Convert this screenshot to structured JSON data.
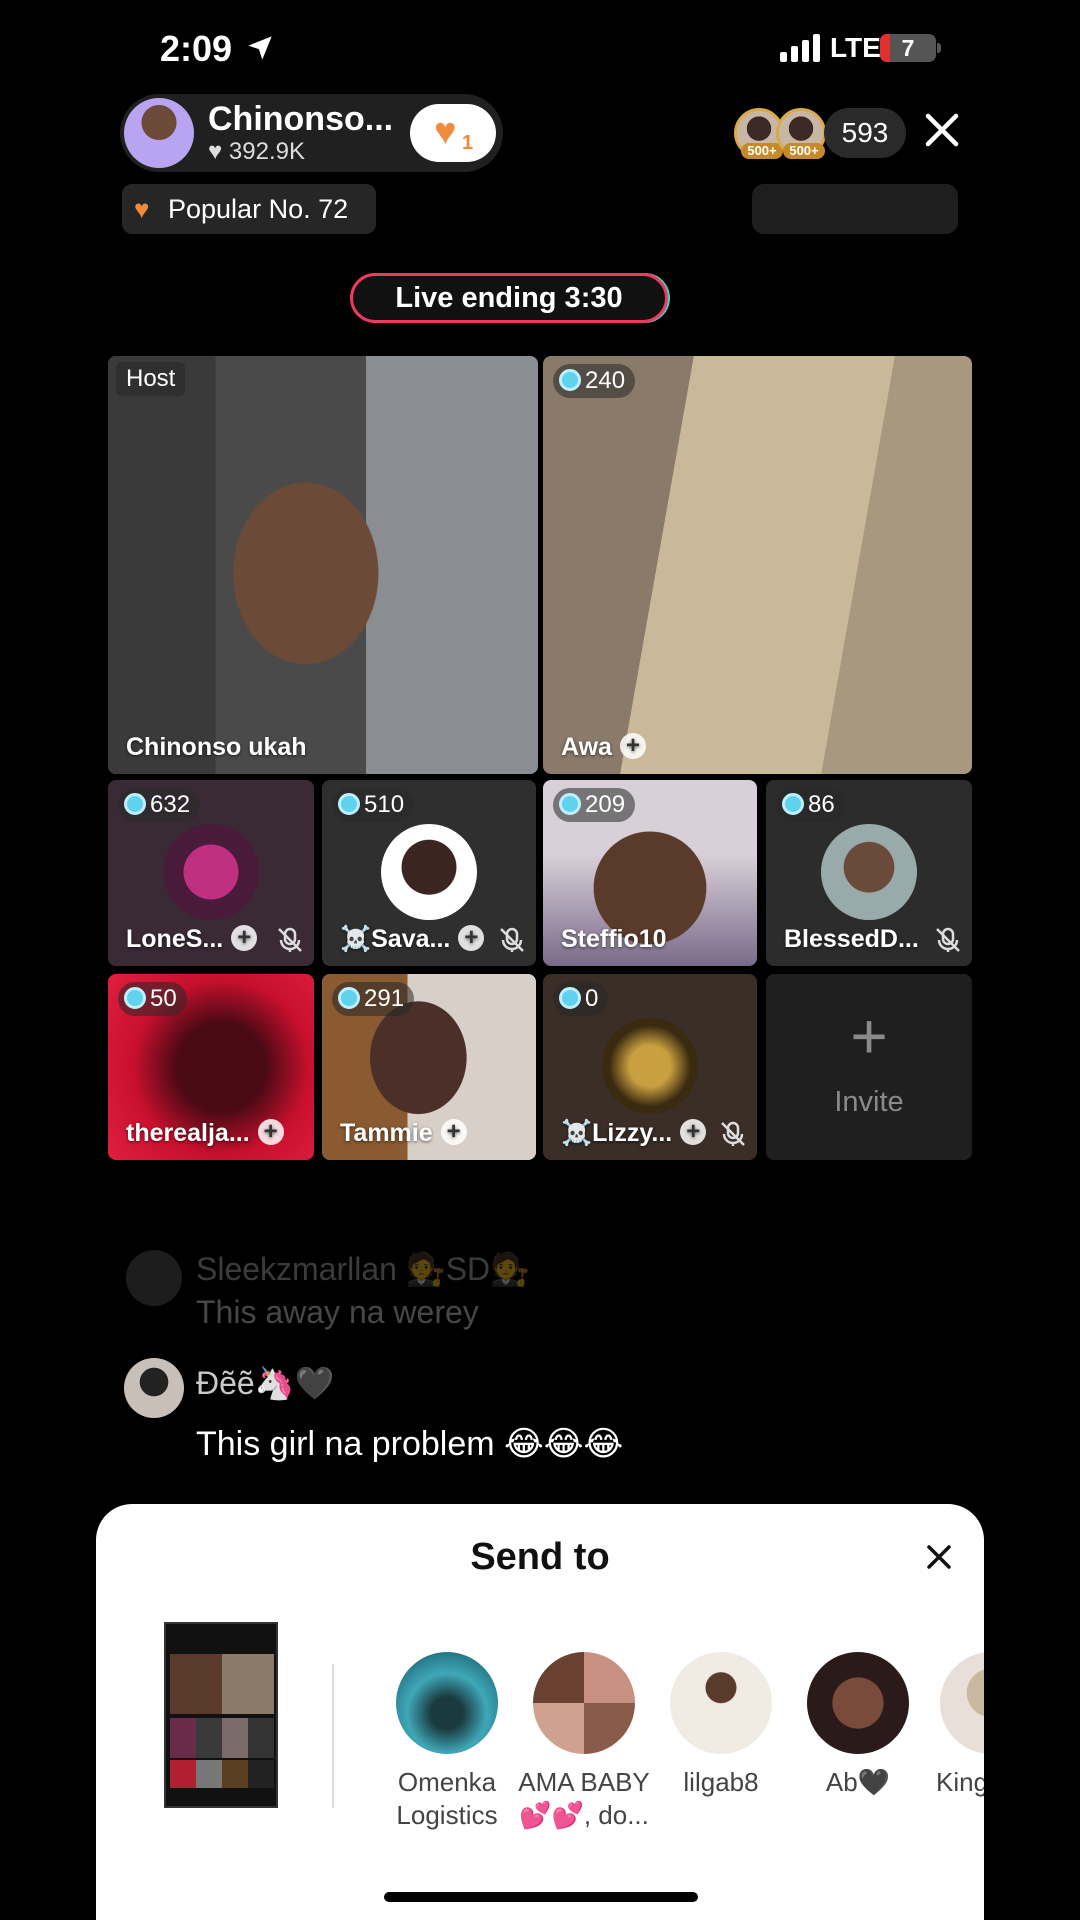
{
  "status_bar": {
    "time": "2:09",
    "network": "LTE",
    "battery": "7"
  },
  "host": {
    "name": "Chinonso...",
    "likes": "392.9K",
    "follow_count": "1"
  },
  "viewers": {
    "badge_1": "500+",
    "badge_2": "500+",
    "count": "593"
  },
  "popular": "Popular No. 72",
  "live_ending": "Live ending 3:30",
  "tiles": {
    "host": {
      "tag": "Host",
      "name": "Chinonso ukah"
    },
    "awa": {
      "count": "240",
      "name": "Awa"
    },
    "lone": {
      "count": "632",
      "name": "LoneS..."
    },
    "sava": {
      "count": "510",
      "name": "☠️Sava..."
    },
    "steffio": {
      "count": "209",
      "name": "Steffio10"
    },
    "blessed": {
      "count": "86",
      "name": "BlessedD..."
    },
    "thereal": {
      "count": "50",
      "name": "therealja..."
    },
    "tammie": {
      "count": "291",
      "name": "Tammie"
    },
    "lizzy": {
      "count": "0",
      "name": "☠️Lizzy..."
    }
  },
  "invite_label": "Invite",
  "chat": [
    {
      "name": "Sleekzmarllan 🧑‍⚖️SD🧑‍⚖️",
      "message": "This away na werey"
    },
    {
      "name": "Đẽẽ🦄🖤",
      "message": "This girl na problem 😂😂😂"
    }
  ],
  "share_sheet": {
    "title": "Send to",
    "contacts": [
      {
        "name": "Omenka Logistics"
      },
      {
        "name": "AMA BABY 💕💕, do..."
      },
      {
        "name": "lilgab8"
      },
      {
        "name": "Ab🖤"
      },
      {
        "name": "King"
      }
    ]
  },
  "colors": {
    "accent_cyan": "#4cc5e0",
    "live_red": "#ef3a5d",
    "heart_orange": "#f08a3c"
  },
  "icons": [
    "location-arrow-icon",
    "signal-icon",
    "battery-icon",
    "heart-icon",
    "close-icon",
    "broken-heart-icon",
    "gem-icon",
    "plus-icon",
    "mic-off-icon"
  ]
}
